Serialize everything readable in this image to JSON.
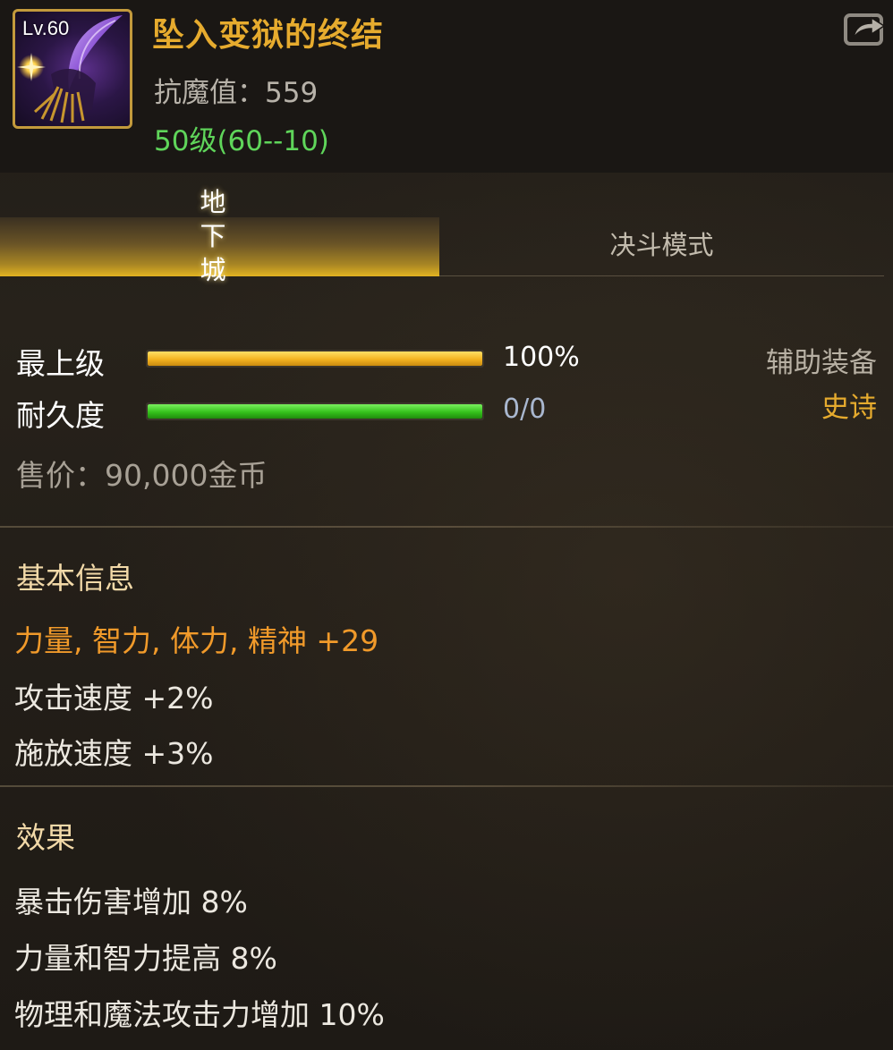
{
  "item": {
    "level_badge": "Lv.60",
    "name": "坠入变狱的终结",
    "stat_line": "抗魔值：559",
    "level_range": "50级(60--10)",
    "type": "辅助装备",
    "grade": "史诗",
    "price": "售价：90,000金币"
  },
  "tabs": [
    {
      "label": "地下城",
      "active": true,
      "chars": [
        "地",
        "下",
        "城"
      ]
    },
    {
      "label": "决斗模式",
      "active": false
    }
  ],
  "bars": {
    "top_grade": {
      "label": "最上级",
      "value_text": "100%",
      "fill_fraction": 1.0
    },
    "durability": {
      "label": "耐久度",
      "value_text": "0/0",
      "fill_fraction": 1.0
    }
  },
  "basic_info": {
    "title": "基本信息",
    "lines": [
      "力量, 智力, 体力, 精神 +29",
      "攻击速度 +2%",
      "施放速度 +3%"
    ]
  },
  "effects": {
    "title": "效果",
    "lines": [
      "暴击伤害增加 8%",
      "力量和智力提高 8%",
      "物理和魔法攻击力增加 10%"
    ]
  },
  "icons": {
    "share": "share-icon",
    "item": "scythe-item-icon"
  },
  "colors": {
    "name": "#e6ab2e",
    "level_range": "#5fd55a",
    "stat_highlight": "#f19a2a",
    "grade": "#e6ab2e"
  }
}
